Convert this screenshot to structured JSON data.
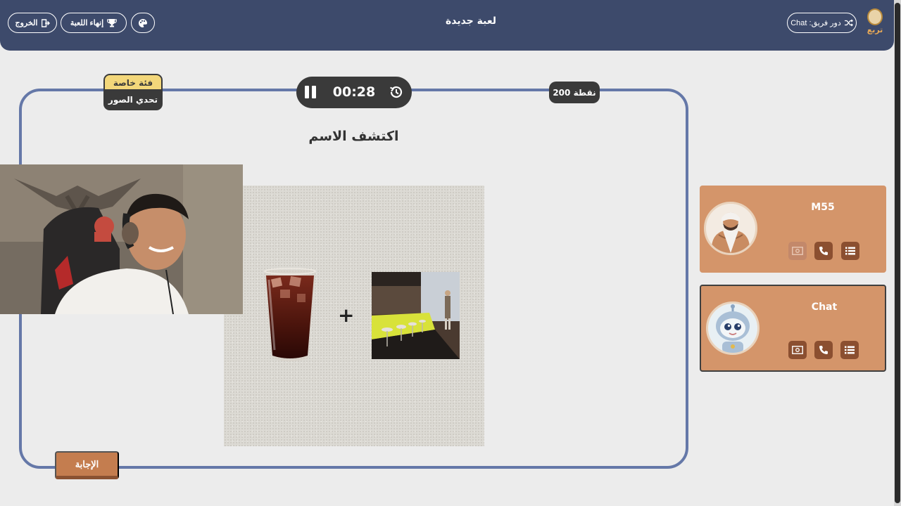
{
  "header": {
    "title": "لعبة جديدة",
    "turn_label": "دور فريق: Chat",
    "logo_text": "تربع",
    "exit_label": "الخروج",
    "end_game_label": "إنهاء اللعبة"
  },
  "round": {
    "timer": "00:28",
    "points": "200 نقطة",
    "category_tag": "فئة خاصة",
    "category_name": "تحدي الصور",
    "question": "اكتشف الاسم",
    "answer_label": "الإجابة"
  },
  "teams": [
    {
      "name": "M55",
      "active": false
    },
    {
      "name": "Chat",
      "active": true
    }
  ],
  "colors": {
    "header_bg": "#3d4a6b",
    "board_border": "#6578a8",
    "team_card_bg": "#d4956a",
    "tool_button": "#8b4f30",
    "answer_button": "#c47d4f"
  },
  "icons": [
    "shuffle-icon",
    "palette-icon",
    "trophy-icon",
    "logout-icon",
    "pause-icon",
    "history-icon",
    "list-icon",
    "phone-icon",
    "money-icon"
  ]
}
